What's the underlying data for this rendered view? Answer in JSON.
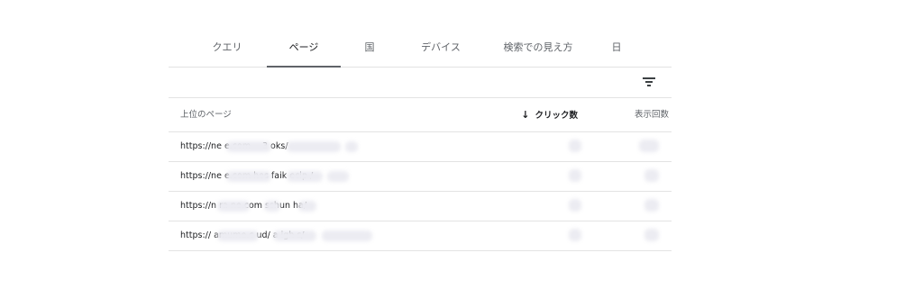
{
  "tabs": [
    {
      "label": "クエリ"
    },
    {
      "label": "ページ",
      "active": true
    },
    {
      "label": "国"
    },
    {
      "label": "デバイス"
    },
    {
      "label": "検索での見え方"
    },
    {
      "label": "日"
    }
  ],
  "toolbar": {
    "filter_icon": "filter-icon"
  },
  "table": {
    "columns": {
      "page": "上位のページ",
      "sort_icon": "↓",
      "clicks": "クリック数",
      "impressions": "表示回数"
    },
    "rows": [
      {
        "url": "https://ne                  e.com                   -       -3      oks/"
      },
      {
        "url": "https://ne                  e.com       hos      faik     ecip      /"
      },
      {
        "url": "https://n          ra     ne.com      sshun       ha/"
      },
      {
        "url": "https://           amume.c         ud/        a       igh       s/"
      }
    ]
  }
}
